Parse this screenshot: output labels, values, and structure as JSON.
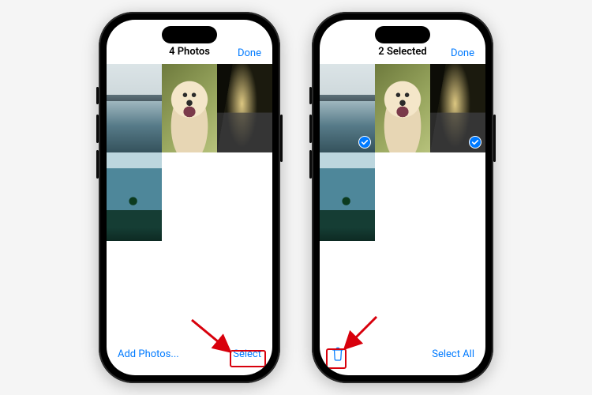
{
  "accent": "#007aff",
  "annotation_color": "#d8000c",
  "left_phone": {
    "title": "4 Photos",
    "done": "Done",
    "toolbar_left": "Add Photos...",
    "toolbar_right": "Select",
    "photos": [
      "lake",
      "dog",
      "road",
      "island"
    ]
  },
  "right_phone": {
    "title": "2 Selected",
    "done": "Done",
    "toolbar_right": "Select All",
    "trash_icon": "trash-icon",
    "photos": [
      "lake",
      "dog",
      "road",
      "island"
    ],
    "selected": [
      0,
      2
    ]
  }
}
